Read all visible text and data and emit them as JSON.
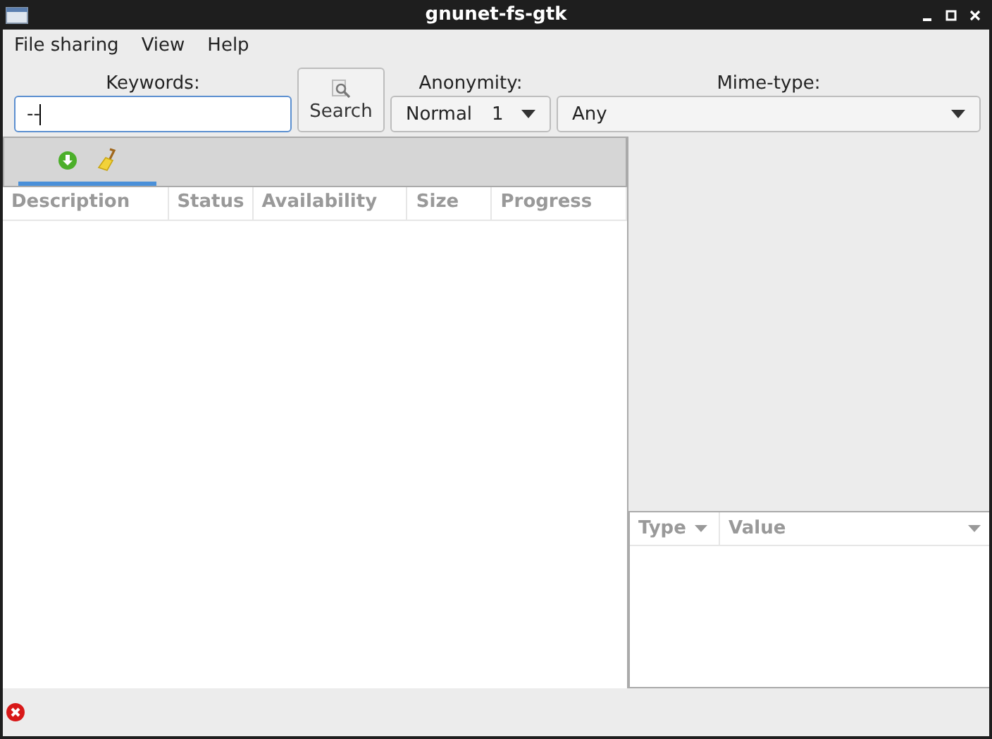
{
  "window": {
    "title": "gnunet-fs-gtk"
  },
  "menu": [
    "File sharing",
    "View",
    "Help"
  ],
  "search": {
    "keywords_label": "Keywords:",
    "keywords_value": "--",
    "button": "Search",
    "anonymity_label": "Anonymity:",
    "anonymity_level": "Normal",
    "anonymity_value": "1",
    "mime_label": "Mime-type:",
    "mime_value": "Any"
  },
  "tabs": [
    {
      "selected": true
    }
  ],
  "results_table": {
    "columns": [
      "Description",
      "Status",
      "Availability",
      "Size",
      "Progress"
    ]
  },
  "metadata_table": {
    "columns": [
      {
        "label": "Type",
        "sort_arrow": true
      },
      {
        "label": "Value",
        "sort_arrow": true
      }
    ]
  },
  "status_bar": {
    "error": true
  }
}
